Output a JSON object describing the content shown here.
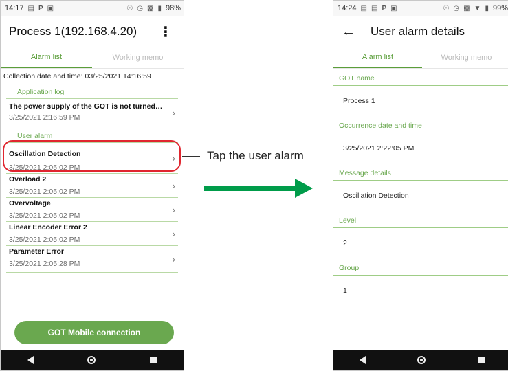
{
  "left_phone": {
    "status": {
      "time": "14:17",
      "battery": "98%"
    },
    "title": "Process 1(192.168.4.20)",
    "menu_icon": "more-vert-icon",
    "tabs": [
      {
        "label": "Alarm list"
      },
      {
        "label": "Working memo"
      }
    ],
    "collection_text": "Collection date and time:  03/25/2021 14:16:59",
    "application_log": {
      "label": "Application log",
      "rows": [
        {
          "message": "The power supply of the GOT is not turned on, o...",
          "time": "3/25/2021 2:16:59 PM"
        }
      ]
    },
    "user_alarm": {
      "label": "User alarm",
      "rows": [
        {
          "message": "Oscillation Detection",
          "time": "3/25/2021 2:05:02 PM"
        },
        {
          "message": "Overload 2",
          "time": "3/25/2021 2:05:02 PM"
        },
        {
          "message": "Overvoltage",
          "time": "3/25/2021 2:05:02 PM"
        },
        {
          "message": "Linear Encoder Error 2",
          "time": "3/25/2021 2:05:02 PM"
        },
        {
          "message": "Parameter Error",
          "time": "3/25/2021 2:05:28 PM"
        }
      ]
    },
    "connect_button": "GOT Mobile connection"
  },
  "callout": {
    "text": "Tap the user alarm"
  },
  "right_phone": {
    "status": {
      "time": "14:24",
      "battery": "99%"
    },
    "title": "User alarm details",
    "tabs": [
      {
        "label": "Alarm list"
      },
      {
        "label": "Working memo"
      }
    ],
    "fields": [
      {
        "label": "GOT name",
        "value": "Process 1"
      },
      {
        "label": "Occurrence date and time",
        "value": "3/25/2021 2:22:05 PM"
      },
      {
        "label": "Message details",
        "value": "Oscillation Detection"
      },
      {
        "label": "Level",
        "value": "2"
      },
      {
        "label": "Group",
        "value": "1"
      }
    ]
  },
  "colors": {
    "accent_green": "#6aa84f",
    "highlight_red": "#e0262f",
    "arrow_green": "#009c4a"
  }
}
